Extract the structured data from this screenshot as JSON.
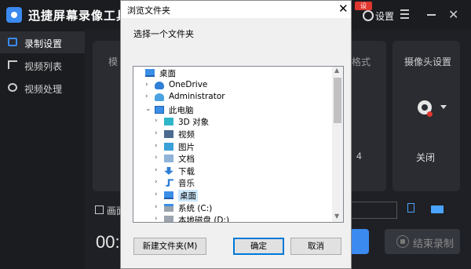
{
  "app": {
    "title": "迅捷屏幕录像工具",
    "vip_badge": "设",
    "settings_label": "设置"
  },
  "sidebar": {
    "items": [
      {
        "label": "录制设置",
        "active": true
      },
      {
        "label": "视频列表",
        "active": false
      },
      {
        "label": "视频处理",
        "active": false
      }
    ]
  },
  "main": {
    "card_peek_left": "模",
    "card_peek_format": "格式",
    "camera_label": "摄像头设置",
    "camera_value": "关闭",
    "peek_left_val": "4",
    "peek_row_label": "画面",
    "timer_peek": "00:",
    "stop_label": "结束录制"
  },
  "dialog": {
    "title": "浏览文件夹",
    "prompt": "选择一个文件夹",
    "tree": [
      {
        "label": "桌面",
        "indent": 0,
        "chevron": "",
        "icon": "desktop-icon",
        "selected": false
      },
      {
        "label": "OneDrive",
        "indent": 1,
        "chevron": "›",
        "icon": "cloud-icon",
        "selected": false
      },
      {
        "label": "Administrator",
        "indent": 1,
        "chevron": "›",
        "icon": "user-icon",
        "selected": false
      },
      {
        "label": "此电脑",
        "indent": 1,
        "chevron": "⌄",
        "icon": "computer-icon",
        "selected": false
      },
      {
        "label": "3D 对象",
        "indent": 2,
        "chevron": "›",
        "icon": "3d-objects-icon",
        "selected": false
      },
      {
        "label": "视频",
        "indent": 2,
        "chevron": "›",
        "icon": "video-icon",
        "selected": false
      },
      {
        "label": "图片",
        "indent": 2,
        "chevron": "›",
        "icon": "pictures-icon",
        "selected": false
      },
      {
        "label": "文档",
        "indent": 2,
        "chevron": "›",
        "icon": "documents-icon",
        "selected": false
      },
      {
        "label": "下载",
        "indent": 2,
        "chevron": "›",
        "icon": "download-icon",
        "selected": false
      },
      {
        "label": "音乐",
        "indent": 2,
        "chevron": "›",
        "icon": "music-icon",
        "selected": false
      },
      {
        "label": "桌面",
        "indent": 2,
        "chevron": "›",
        "icon": "desktop-icon",
        "selected": true
      },
      {
        "label": "系统 (C:)",
        "indent": 2,
        "chevron": "›",
        "icon": "system-drive-icon",
        "selected": false
      },
      {
        "label": "本地磁盘 (D:)",
        "indent": 2,
        "chevron": "›",
        "icon": "local-disk-icon",
        "selected": false
      }
    ],
    "buttons": {
      "new_folder": "新建文件夹(M)",
      "ok": "确定",
      "cancel": "取消"
    }
  },
  "colors": {
    "accent": "#3b8af0",
    "danger": "#e0362f",
    "app_bg": "#1f2025",
    "dialog_bg": "#f0f0f0",
    "selection": "#cce8ff"
  }
}
